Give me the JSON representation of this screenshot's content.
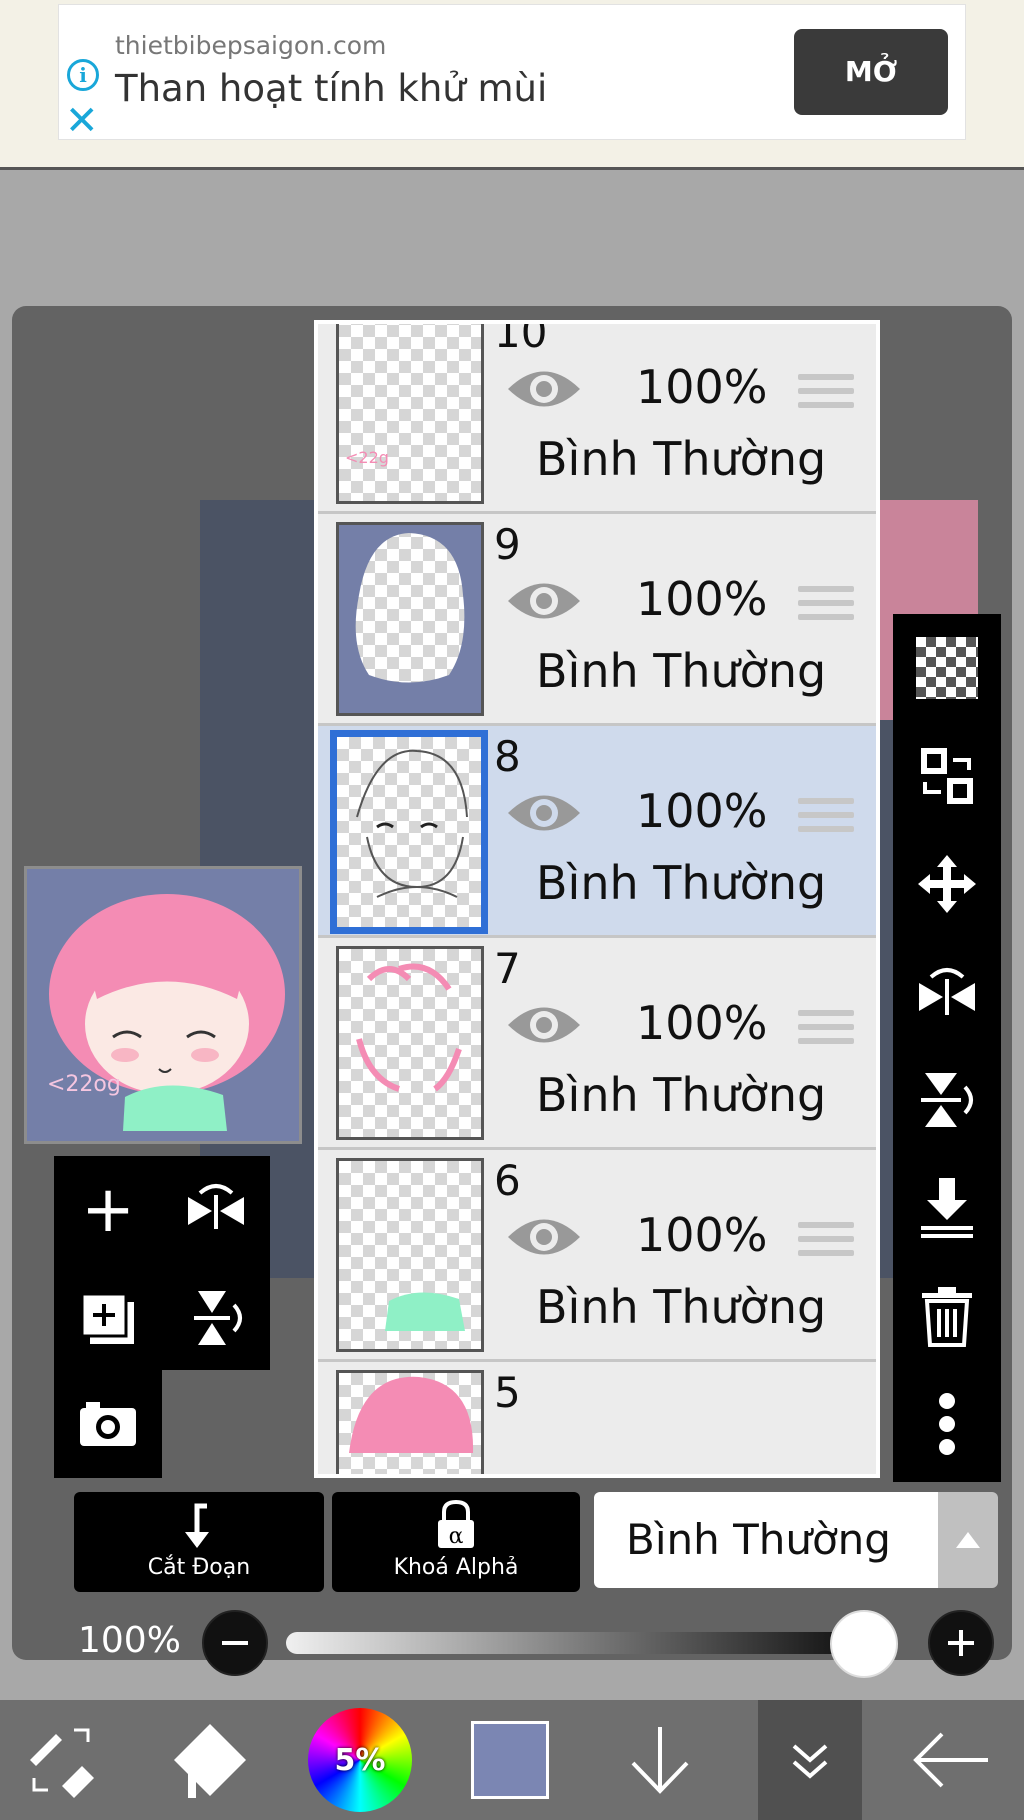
{
  "ad": {
    "domain": "thietbibepsaigon.com",
    "headline": "Than hoạt tính khử mùi",
    "open_label": "MỞ"
  },
  "layers": [
    {
      "number": "10",
      "opacity": "100%",
      "blend": "Bình Thường",
      "selected": false
    },
    {
      "number": "9",
      "opacity": "100%",
      "blend": "Bình Thường",
      "selected": false
    },
    {
      "number": "8",
      "opacity": "100%",
      "blend": "Bình Thường",
      "selected": true
    },
    {
      "number": "7",
      "opacity": "100%",
      "blend": "Bình Thường",
      "selected": false
    },
    {
      "number": "6",
      "opacity": "100%",
      "blend": "Bình Thường",
      "selected": false
    },
    {
      "number": "5",
      "opacity": "",
      "blend": "",
      "selected": false
    }
  ],
  "bottom_controls": {
    "clip_label": "Cắt Đoạn",
    "alpha_lock_label": "Khoá Alphả",
    "blend_mode": "Bình Thường",
    "opacity_label": "100%",
    "opacity_value": 1.0
  },
  "bottombar": {
    "brush_size_percent": "5%",
    "current_color": "#7b86b3"
  },
  "colors": {
    "selected_layer": "#cfdaec",
    "selected_border": "#2f6fd6",
    "ad_accent": "#19a7d9"
  }
}
